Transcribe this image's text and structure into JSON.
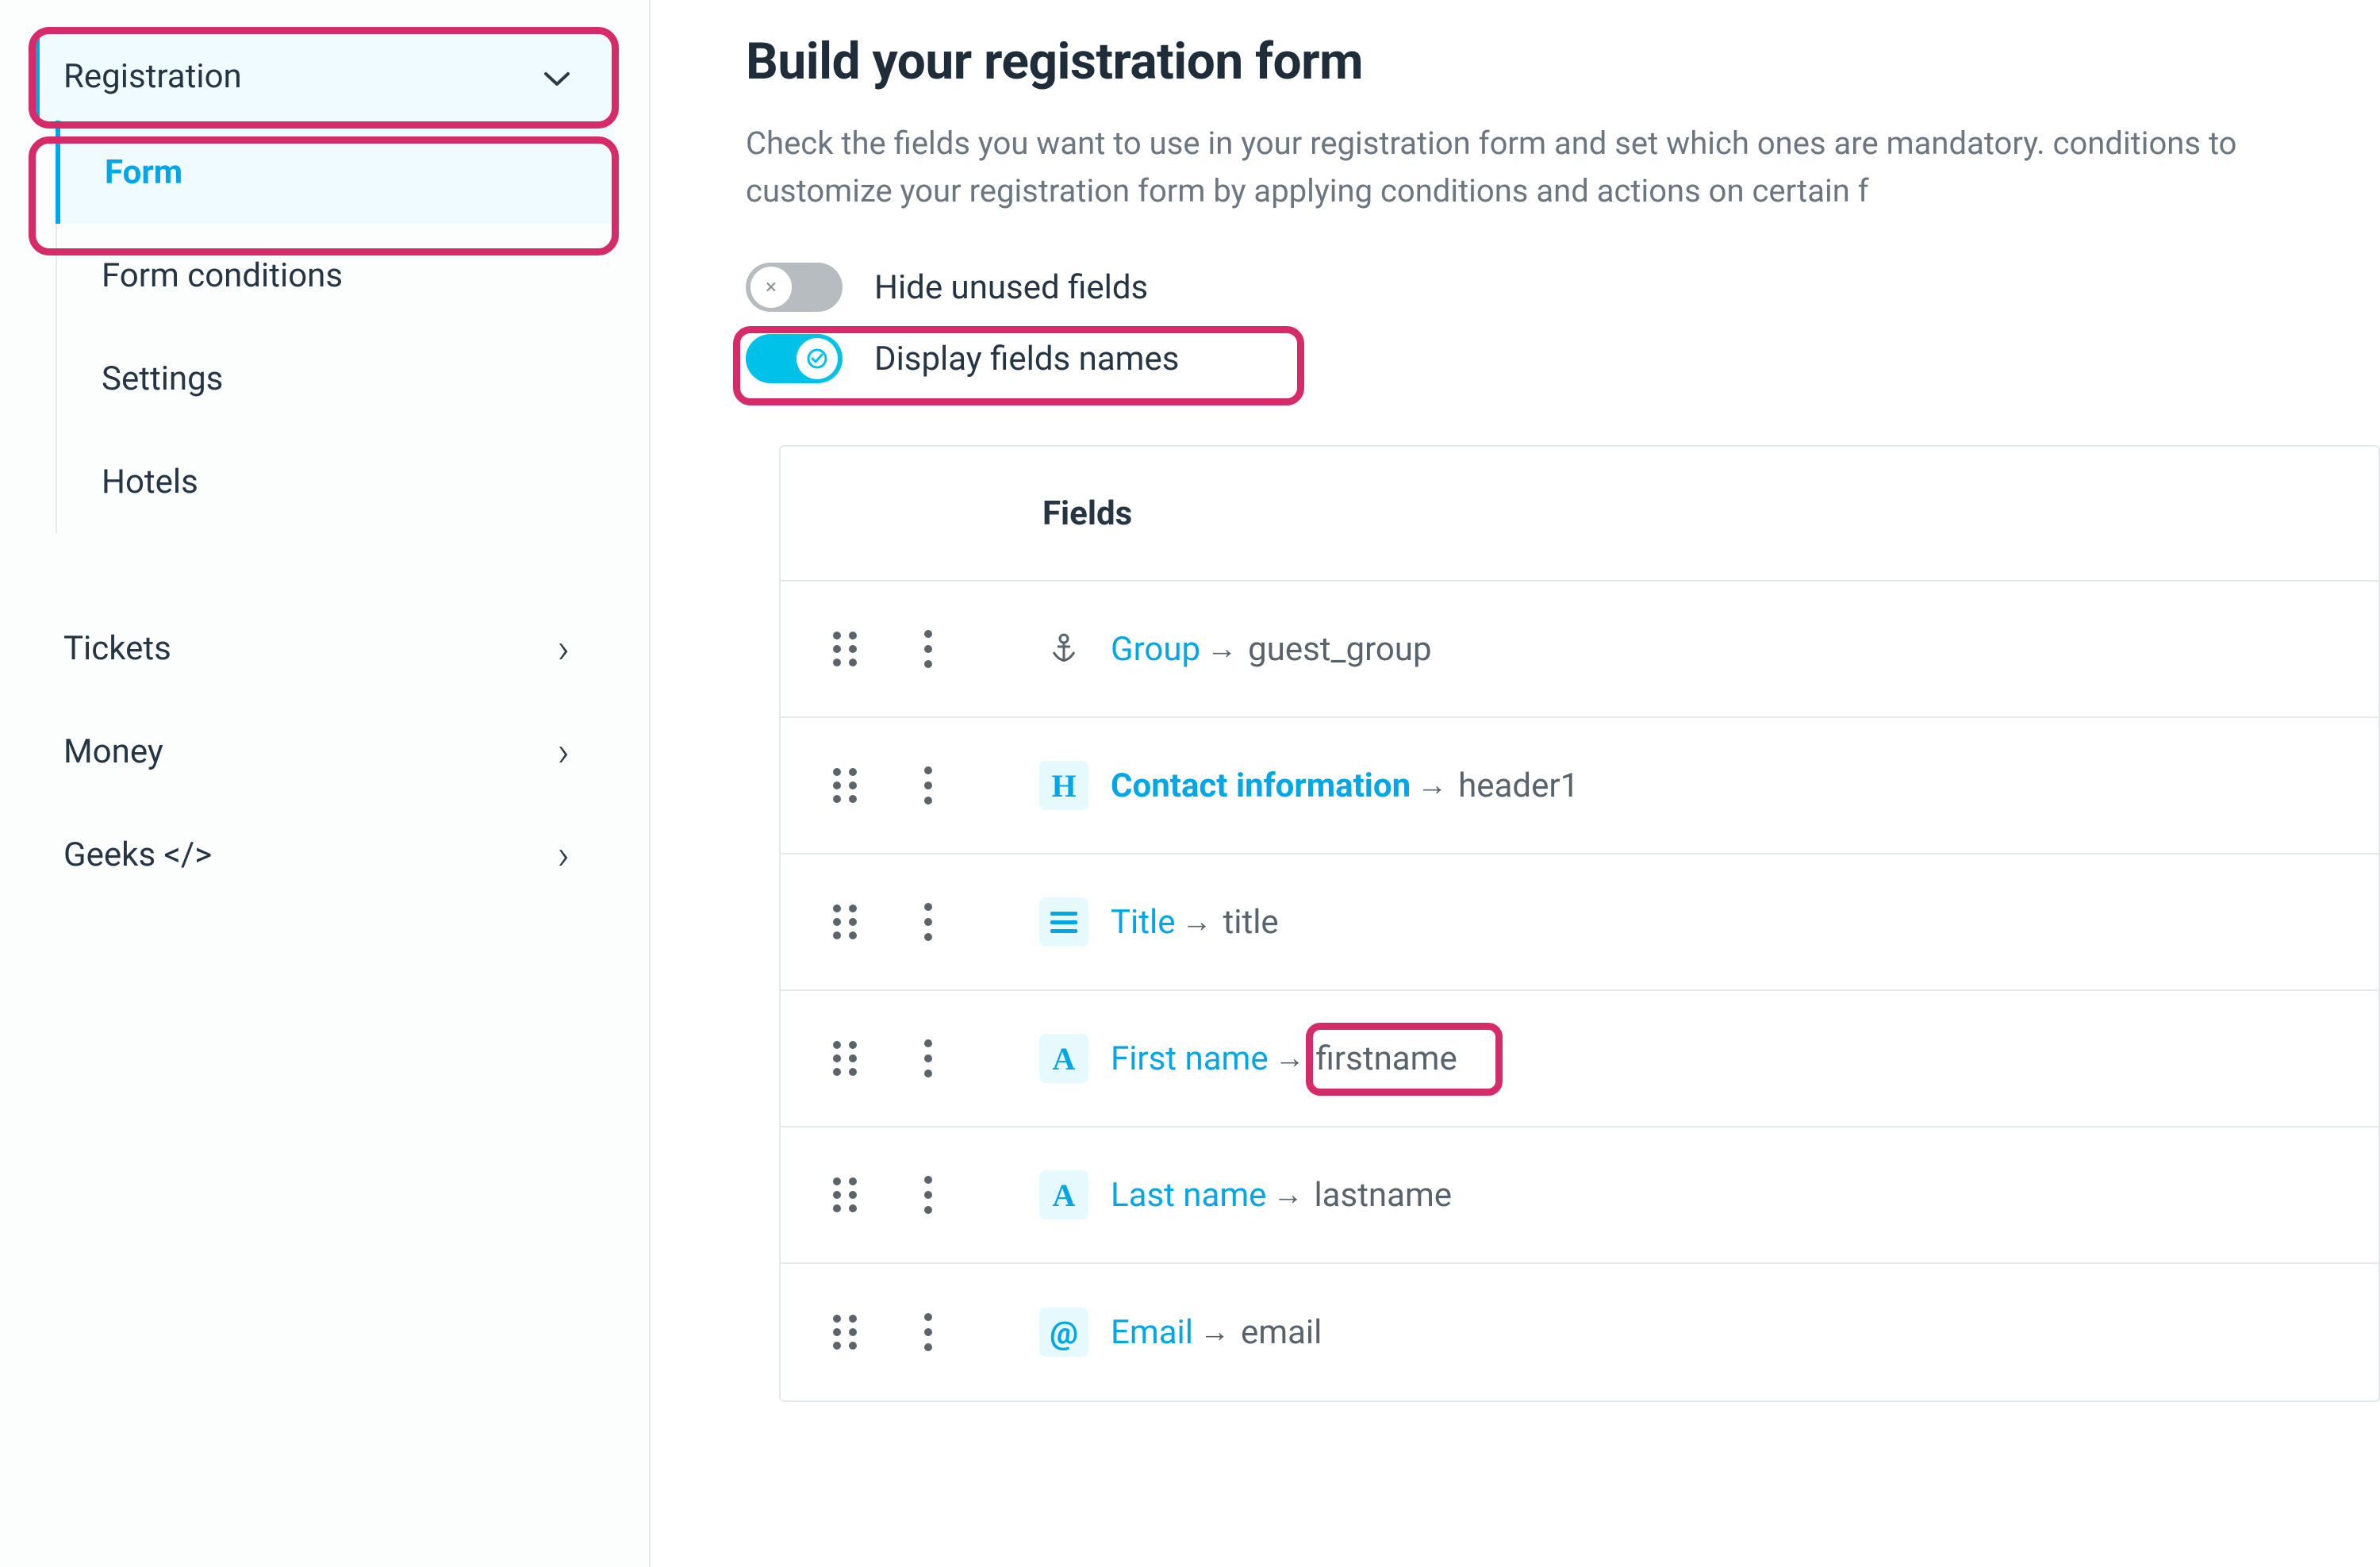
{
  "sidebar": {
    "expanded_section": "Registration",
    "sub_items": [
      "Form",
      "Form conditions",
      "Settings",
      "Hotels"
    ],
    "active_sub_index": 0,
    "collapsed_sections": [
      "Tickets",
      "Money",
      "Geeks </>"
    ]
  },
  "main": {
    "title": "Build your registration form",
    "subtitle": "Check the fields you want to use in your registration form and set which ones are mandatory. conditions to customize your registration form by applying conditions and actions on certain f",
    "toggles": {
      "hide_unused": {
        "label": "Hide unused fields",
        "on": false
      },
      "display_names": {
        "label": "Display fields names",
        "on": true
      }
    },
    "fields_header": "Fields",
    "rows": [
      {
        "icon": "anchor",
        "tinted": false,
        "label": "Group",
        "label_bold": false,
        "name": "guest_group"
      },
      {
        "icon": "H",
        "tinted": true,
        "label": "Contact information",
        "label_bold": true,
        "name": "header1"
      },
      {
        "icon": "lines",
        "tinted": true,
        "label": "Title",
        "label_bold": false,
        "name": "title"
      },
      {
        "icon": "A",
        "tinted": true,
        "label": "First name",
        "label_bold": false,
        "name": "firstname"
      },
      {
        "icon": "A",
        "tinted": true,
        "label": "Last name",
        "label_bold": false,
        "name": "lastname"
      },
      {
        "icon": "@",
        "tinted": true,
        "label": "Email",
        "label_bold": false,
        "name": "email"
      }
    ]
  }
}
